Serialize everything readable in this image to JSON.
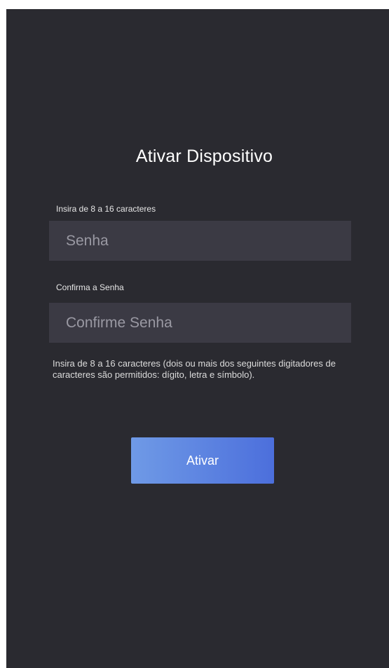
{
  "page": {
    "title": "Ativar Dispositivo"
  },
  "form": {
    "password": {
      "label": "Insira de 8 a 16 caracteres",
      "placeholder": "Senha",
      "value": ""
    },
    "confirm": {
      "label": "Confirma a Senha",
      "placeholder": "Confirme Senha",
      "value": ""
    },
    "hint": "Insira de 8 a 16 caracteres (dois ou mais dos seguintes digitadores de caracteres são permitidos: dígito, letra e símbolo).",
    "submit_label": "Ativar"
  },
  "colors": {
    "background": "#2a2a30",
    "input_background": "#3b3a44",
    "button_gradient_start": "#6f9ae6",
    "button_gradient_end": "#4c6fdc"
  }
}
